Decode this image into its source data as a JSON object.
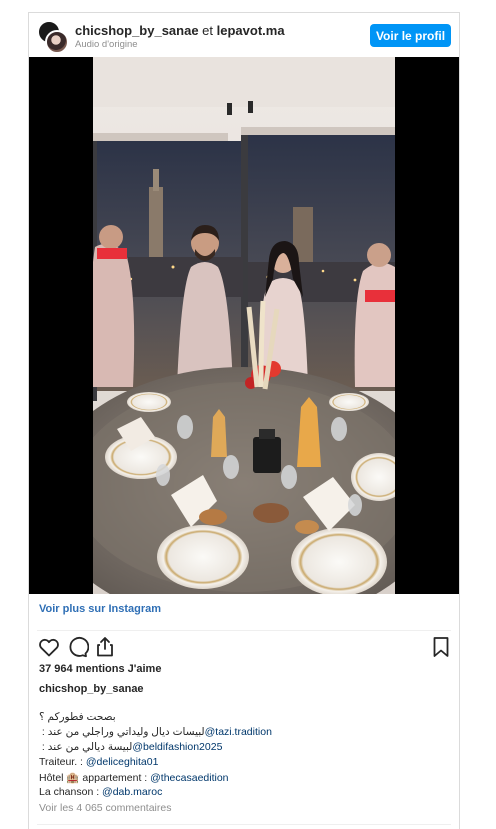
{
  "header": {
    "account_primary": "chicshop_by_sanae",
    "connector": " et ",
    "account_secondary": "lepavot.ma",
    "audio": "Audio d'origine",
    "profile_button": "Voir le profil"
  },
  "media": {
    "kind": "video",
    "redaction_color": "#e8303a"
  },
  "links": {
    "more_on_instagram": "Voir plus sur Instagram"
  },
  "actions": {
    "icons": [
      "heart-icon",
      "comment-icon",
      "share-icon",
      "bookmark-icon"
    ]
  },
  "post": {
    "likes": "37 964 mentions J'aime",
    "username": "chicshop_by_sanae",
    "caption": {
      "line1": "بصحت فطوركم ؟",
      "line2_text": "لبيسات ديال وليداتي وراجلي من عند : ",
      "line2_mention": "@tazi.tradition",
      "line3_text": "لبيسة ديالي من عند : ",
      "line3_mention": "@beldifashion2025",
      "line4_text": "Traiteur. : ",
      "line4_mention": "@deliceghita01",
      "line5_text": "Hôtel 🏨 appartement : ",
      "line5_mention": "@thecasaedition",
      "line6_text": "La chanson : ",
      "line6_mention": "@dab.maroc"
    },
    "comments": "Voir les 4 065 commentaires"
  },
  "colors": {
    "accent": "#0095f6",
    "link": "#00376b",
    "muted": "#8e8e8e",
    "border": "#dbdbdb"
  }
}
